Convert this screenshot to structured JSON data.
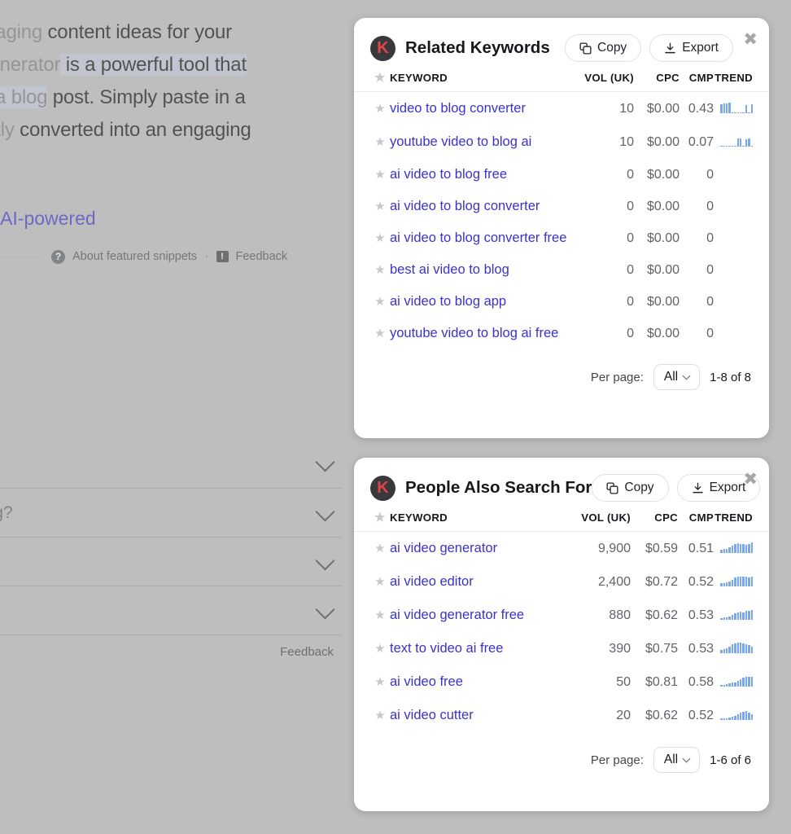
{
  "backdrop": {
    "snippet_lines": [
      {
        "fade": "ngaging",
        "rest": " content ideas for your"
      },
      {
        "fade": "Generator",
        "rest": " is a powerful tool that"
      },
      {
        "fade": "to a blog",
        "rest": " post. Simply paste in a"
      },
      {
        "fade": "antly",
        "rest": " converted into an engaging"
      }
    ],
    "ai_powered": "AI-powered",
    "about_featured_snippets": "About featured snippets",
    "separator": "·",
    "feedback": "Feedback",
    "help_icon": "?",
    "flag_icon": "!",
    "accordion_rows": [
      "",
      "log?",
      "",
      ""
    ],
    "accordion_feedback": "Feedback"
  },
  "cards": [
    {
      "id": "related-keywords",
      "logo_letter": "K",
      "title": "Related Keywords",
      "copy_label": "Copy",
      "export_label": "Export",
      "close_label": "✖",
      "columns": [
        "KEYWORD",
        "VOL (UK)",
        "CPC",
        "CMP",
        "TREND"
      ],
      "rows": [
        {
          "keyword": "video to blog converter",
          "vol": "10",
          "cpc": "$0.00",
          "cmp": "0.43",
          "trend": [
            70,
            78,
            74,
            80,
            6,
            4,
            5,
            4,
            6,
            60,
            5,
            66
          ]
        },
        {
          "keyword": "youtube video to blog ai",
          "vol": "10",
          "cpc": "$0.00",
          "cmp": "0.07",
          "trend": [
            4,
            4,
            4,
            5,
            4,
            4,
            60,
            62,
            5,
            58,
            60,
            4
          ]
        },
        {
          "keyword": "ai video to blog free",
          "vol": "0",
          "cpc": "$0.00",
          "cmp": "0",
          "trend": []
        },
        {
          "keyword": "ai video to blog converter",
          "vol": "0",
          "cpc": "$0.00",
          "cmp": "0",
          "trend": []
        },
        {
          "keyword": "ai video to blog converter free",
          "vol": "0",
          "cpc": "$0.00",
          "cmp": "0",
          "trend": []
        },
        {
          "keyword": "best ai video to blog",
          "vol": "0",
          "cpc": "$0.00",
          "cmp": "0",
          "trend": []
        },
        {
          "keyword": "ai video to blog app",
          "vol": "0",
          "cpc": "$0.00",
          "cmp": "0",
          "trend": []
        },
        {
          "keyword": "youtube video to blog ai free",
          "vol": "0",
          "cpc": "$0.00",
          "cmp": "0",
          "trend": []
        }
      ],
      "per_page_label": "Per page:",
      "per_page_value": "All",
      "range_label": "1-8 of 8"
    },
    {
      "id": "people-also-search-for",
      "logo_letter": "K",
      "title": "People Also Search For",
      "copy_label": "Copy",
      "export_label": "Export",
      "close_label": "✖",
      "columns": [
        "KEYWORD",
        "VOL (UK)",
        "CPC",
        "CMP",
        "TREND"
      ],
      "rows": [
        {
          "keyword": "ai video generator",
          "vol": "9,900",
          "cpc": "$0.59",
          "cmp": "0.51",
          "trend": [
            26,
            30,
            34,
            42,
            58,
            70,
            74,
            70,
            66,
            62,
            70,
            82
          ]
        },
        {
          "keyword": "ai video editor",
          "vol": "2,400",
          "cpc": "$0.72",
          "cmp": "0.52",
          "trend": [
            22,
            26,
            30,
            38,
            52,
            66,
            74,
            78,
            74,
            72,
            70,
            72
          ]
        },
        {
          "keyword": "ai video generator free",
          "vol": "880",
          "cpc": "$0.62",
          "cmp": "0.53",
          "trend": [
            14,
            16,
            20,
            26,
            36,
            48,
            58,
            62,
            56,
            66,
            70,
            78
          ]
        },
        {
          "keyword": "text to video ai free",
          "vol": "390",
          "cpc": "$0.75",
          "cmp": "0.53",
          "trend": [
            26,
            32,
            40,
            52,
            66,
            78,
            82,
            80,
            76,
            70,
            60,
            52
          ]
        },
        {
          "keyword": "ai video free",
          "vol": "50",
          "cpc": "$0.81",
          "cmp": "0.58",
          "trend": [
            12,
            14,
            18,
            22,
            30,
            34,
            44,
            58,
            70,
            74,
            78,
            74
          ]
        },
        {
          "keyword": "ai video cutter",
          "vol": "20",
          "cpc": "$0.62",
          "cmp": "0.52",
          "trend": [
            10,
            12,
            14,
            18,
            24,
            34,
            46,
            54,
            62,
            70,
            58,
            46
          ]
        }
      ],
      "per_page_label": "Per page:",
      "per_page_value": "All",
      "range_label": "1-6 of 6"
    }
  ],
  "colors": {
    "page_background": "#bebebe",
    "card_background": "#ffffff",
    "link": "#3b32cc",
    "brand_logo_bg": "#37393d",
    "brand_logo_fg": "#e2444a",
    "sparkline": "#7aa7ef",
    "muted_text": "#5f6368"
  }
}
